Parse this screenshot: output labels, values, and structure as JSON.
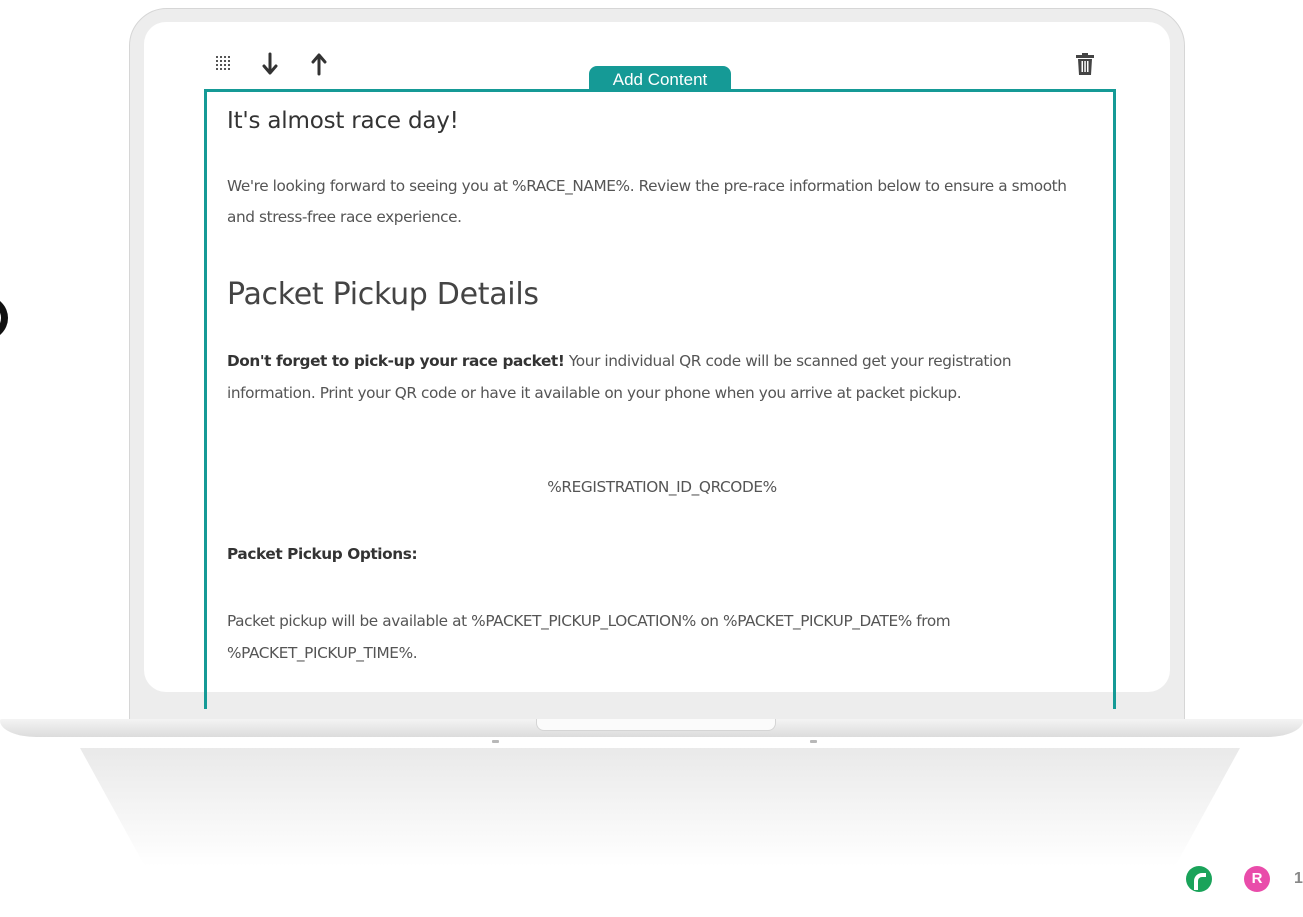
{
  "toolbar": {
    "drag_icon": "drag-handle-icon",
    "move_down_icon": "arrow-down-icon",
    "move_up_icon": "arrow-up-icon",
    "delete_icon": "trash-icon",
    "add_content_label": "Add Content"
  },
  "email": {
    "heading": "It's almost race day!",
    "intro": "We're looking forward to seeing you at %RACE_NAME%. Review the pre-race information below to ensure a smooth and stress-free race experience.",
    "section_title": "Packet Pickup Details",
    "pickup_bold": "Don't forget to pick-up your race packet!",
    "pickup_text": " Your individual QR code will be scanned get your registration information. Print your QR code or have it available on your phone when you arrive at packet pickup.",
    "qrcode_token": "%REGISTRATION_ID_QRCODE%",
    "options_heading": "Packet Pickup Options:",
    "options_text": "Packet pickup will be available at %PACKET_PICKUP_LOCATION% on %PACKET_PICKUP_DATE% from %PACKET_PICKUP_TIME%."
  },
  "badges": {
    "pink_letter": "R",
    "count": "1"
  },
  "colors": {
    "accent": "#159a96",
    "badge_green": "#1aa35a",
    "badge_pink": "#e94caa"
  }
}
